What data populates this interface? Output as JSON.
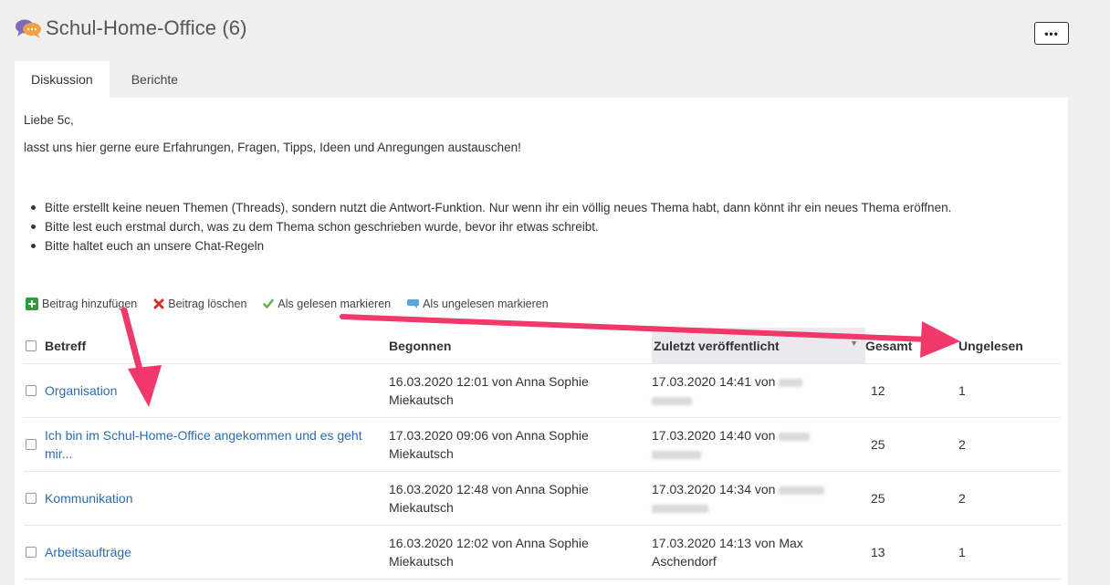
{
  "header": {
    "title": "Schul-Home-Office (6)",
    "icon": "chat-bubbles-icon",
    "more_label": "•••"
  },
  "tabs": [
    {
      "label": "Diskussion",
      "active": true
    },
    {
      "label": "Berichte",
      "active": false
    }
  ],
  "intro": {
    "greeting": "Liebe 5c,",
    "text": "lasst uns hier gerne eure Erfahrungen, Fragen, Tipps, Ideen und Anregungen austauschen!"
  },
  "rules": [
    "Bitte erstellt keine neuen Themen (Threads), sondern nutzt die Antwort-Funktion. Nur wenn ihr ein völlig neues Thema habt, dann könnt ihr ein neues Thema eröffnen.",
    "Bitte lest euch erstmal durch, was zu dem Thema schon geschrieben wurde, bevor ihr etwas schreibt.",
    "Bitte haltet euch an unsere Chat-Regeln"
  ],
  "actions": {
    "add": "Beitrag hinzufügen",
    "delete": "Beitrag löschen",
    "mark_read": "Als gelesen markieren",
    "mark_unread": "Als ungelesen markieren"
  },
  "table": {
    "headers": {
      "subject": "Betreff",
      "started": "Begonnen",
      "last_posted": "Zuletzt veröffentlicht",
      "total": "Gesamt",
      "unread": "Ungelesen"
    },
    "rows": [
      {
        "subject": "Organisation",
        "started": "16.03.2020 12:01 von Anna Sophie Miekautsch",
        "last": "17.03.2020 14:41 von",
        "total": "12",
        "unread": "1"
      },
      {
        "subject": "Ich bin im Schul-Home-Office angekommen und es geht mir...",
        "started": "17.03.2020 09:06 von Anna Sophie Miekautsch",
        "last": "17.03.2020 14:40 von",
        "total": "25",
        "unread": "2"
      },
      {
        "subject": "Kommunikation",
        "started": "16.03.2020 12:48 von Anna Sophie Miekautsch",
        "last": "17.03.2020 14:34 von",
        "total": "25",
        "unread": "2"
      },
      {
        "subject": "Arbeitsaufträge",
        "started": "16.03.2020 12:02 von Anna Sophie Miekautsch",
        "last": "17.03.2020 14:13 von Max Aschendorf",
        "total": "13",
        "unread": "1"
      }
    ]
  },
  "colors": {
    "link": "#2b6cb0",
    "annotation_arrow": "#f0386b",
    "add_icon": "#2e9e3a",
    "delete_icon": "#d32f2f",
    "check_icon": "#6ab04c",
    "unread_icon": "#5aa7d8"
  }
}
